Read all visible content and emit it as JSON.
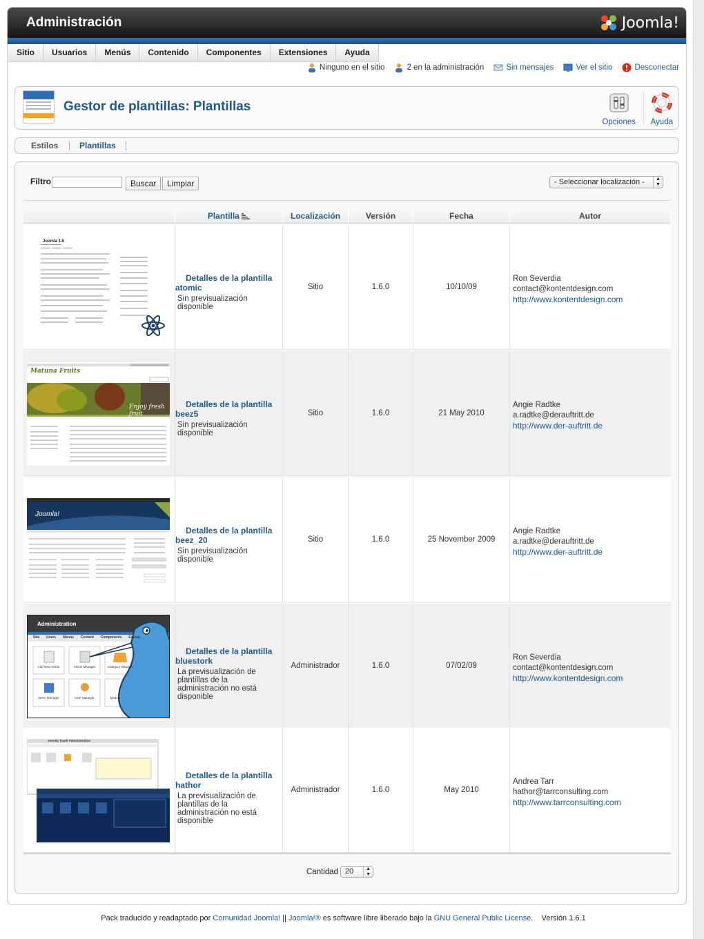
{
  "header": {
    "title": "Administración",
    "logo_text": "Joomla!"
  },
  "menu": [
    {
      "label": "Sitio"
    },
    {
      "label": "Usuarios"
    },
    {
      "label": "Menús"
    },
    {
      "label": "Contenido"
    },
    {
      "label": "Componentes"
    },
    {
      "label": "Extensiones"
    },
    {
      "label": "Ayuda"
    }
  ],
  "status": {
    "site_users": "Ninguno en el sitio",
    "admin_users": "2 en la administración",
    "messages": "Sin mensajes",
    "view_site": "Ver el sitio",
    "logout": "Desconectar"
  },
  "toolbar": {
    "title": "Gestor de plantillas: Plantillas",
    "options_label": "Opciones",
    "help_label": "Ayuda"
  },
  "subtabs": [
    {
      "label": "Estilos"
    },
    {
      "label": "Plantillas",
      "active": true
    }
  ],
  "filter": {
    "label": "Filtro:",
    "value": "",
    "search_btn": "Buscar",
    "clear_btn": "Limpiar",
    "location_select": "- Seleccionar localización -"
  },
  "table": {
    "headers": {
      "template": "Plantilla",
      "location": "Localización",
      "version": "Versión",
      "date": "Fecha",
      "author": "Autor"
    },
    "rows": [
      {
        "details_prefix": "Detalles de la plantilla",
        "name": "atomic",
        "preview": "Sin previsualización disponible",
        "location": "Sitio",
        "version": "1.6.0",
        "date": "10/10/09",
        "author": "Ron Severdia",
        "email": "contact@kontentdesign.com",
        "url": "http://www.kontentdesign.com"
      },
      {
        "details_prefix": "Detalles de la plantilla",
        "name": "beez5",
        "preview": "Sin previsualización disponible",
        "location": "Sitio",
        "version": "1.6.0",
        "date": "21 May 2010",
        "author": "Angie Radtke",
        "email": "a.radtke@derauftritt.de",
        "url": "http://www.der-auftritt.de"
      },
      {
        "details_prefix": "Detalles de la plantilla",
        "name": "beez_20",
        "preview": "Sin previsualización disponible",
        "location": "Sitio",
        "version": "1.6.0",
        "date": "25 November 2009",
        "author": "Angie Radtke",
        "email": "a.radtke@derauftritt.de",
        "url": "http://www.der-auftritt.de"
      },
      {
        "details_prefix": "Detalles de la plantilla",
        "name": "bluestork",
        "preview": "La previsualización de plantillas de la administración no está disponible",
        "location": "Administrador",
        "version": "1.6.0",
        "date": "07/02/09",
        "author": "Ron Severdia",
        "email": "contact@kontentdesign.com",
        "url": "http://www.kontentdesign.com"
      },
      {
        "details_prefix": "Detalles de la plantilla",
        "name": "hathor",
        "preview": "La previsualización de plantillas de la administración no está disponible",
        "location": "Administrador",
        "version": "1.6.0",
        "date": "May 2010",
        "author": "Andrea Tarr",
        "email": "hathor@tarrconsulting.com",
        "url": "http://www.tarrconsulting.com"
      }
    ]
  },
  "thumbs": {
    "atomic_title": "Joomla 1.6",
    "beez5_title": "Matuna Fruits",
    "beez5_tagline": "Enjoy fresh fruit",
    "beez20_title": "Joomla!",
    "bluestork_title": "Administration",
    "bluestork_menu": [
      "Site",
      "Users",
      "Menus",
      "Content",
      "Components",
      "Extens"
    ],
    "bluestork_icons": [
      "Add New Article",
      "Article Manager",
      "Category Manager",
      "Menu Manager",
      "User Manager",
      "Module"
    ],
    "hathor_title": "Joomla Trunk Administration"
  },
  "pagination": {
    "label": "Cantidad",
    "value": "20"
  },
  "footer": {
    "prefix": "Pack traducido y readaptado por",
    "community": "Comunidad Joomla!",
    "sep": "||",
    "joomla": "Joomla!®",
    "middle": "es software libre liberado bajo la",
    "license": "GNU General Public License.",
    "version": "Versión 1.6.1"
  },
  "colors": {
    "accent": "#1f5a8f",
    "header_dark": "#1a1a1a",
    "blue_bar": "#2e72b8"
  }
}
